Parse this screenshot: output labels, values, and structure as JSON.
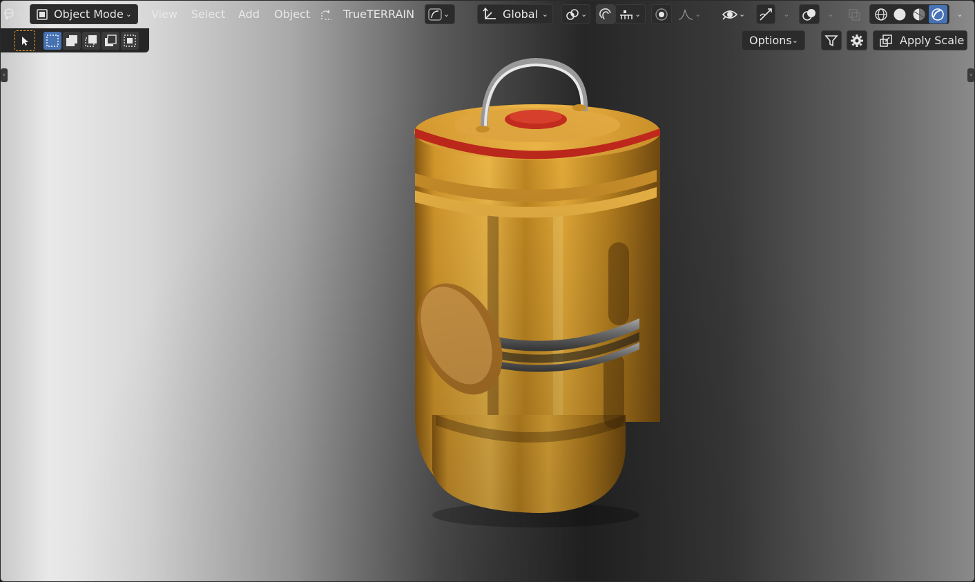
{
  "header": {
    "editor_type_icon": "globe-editor-icon",
    "mode": {
      "label": "Object Mode",
      "icon": "object-mode-icon"
    },
    "menus": [
      "View",
      "Select",
      "Add",
      "Object"
    ],
    "addon": {
      "label": "TrueTERRAIN",
      "icon": "terrain-icon"
    },
    "transform_orientation": {
      "label": "Global",
      "icon": "orientation-axes-icon"
    },
    "pivot_icon": "pivot-point-icon",
    "snap_icon": "magnet-snap-icon",
    "snap_target_icon": "snap-increment-icon",
    "proportional_icon": "proportional-edit-icon",
    "falloff_icon": "falloff-curve-icon",
    "visibility_icon": "eye-icon",
    "gizmo_icon": "gizmo-icon",
    "overlay_icon": "overlay-icon",
    "xray_icon": "xray-icon",
    "shading_modes": [
      "wireframe-icon",
      "solid-icon",
      "material-preview-icon",
      "rendered-icon"
    ],
    "active_shading": "rendered-icon"
  },
  "toolbar": {
    "tool_icon": "select-cursor-icon",
    "select_modes": [
      "select-box-new-icon",
      "select-extend-icon",
      "select-subtract-icon",
      "select-difference-icon",
      "select-intersect-icon"
    ],
    "options_label": "Options",
    "filter_icon": "filter-icon",
    "settings_icon": "gear-icon",
    "apply_scale": {
      "label": "Apply Scale",
      "icon": "apply-scale-icon"
    }
  },
  "colors": {
    "accent": "#4772b3",
    "tool_active": "#f5a623",
    "object_body": "#e0a030",
    "object_rim": "#c0281c"
  }
}
